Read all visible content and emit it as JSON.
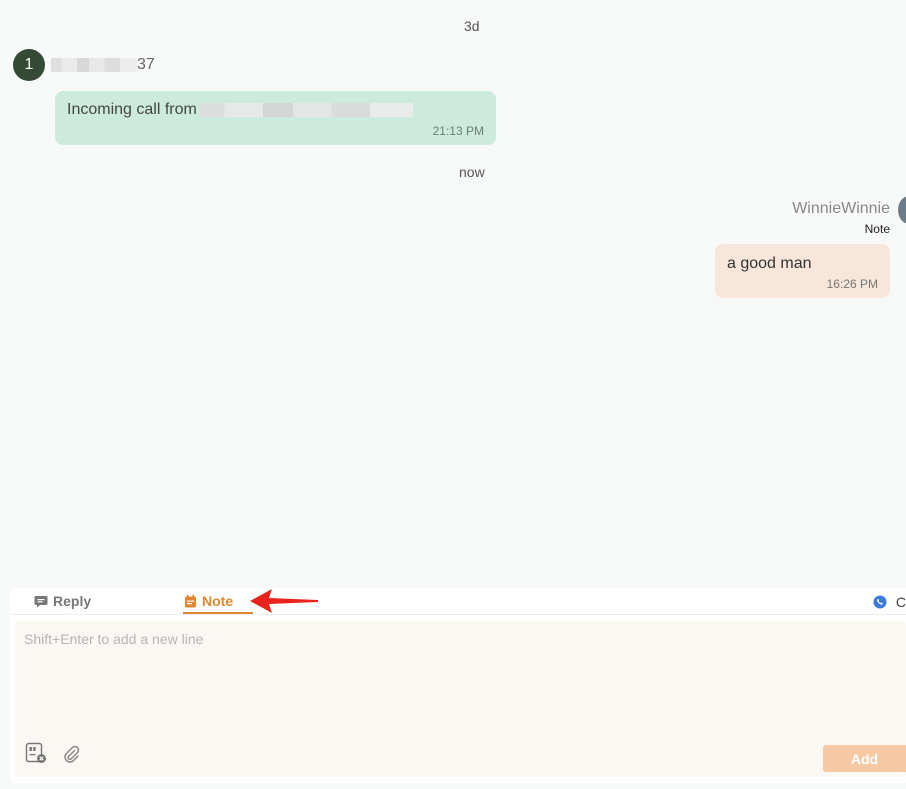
{
  "timeline": {
    "separator_1": "3d",
    "separator_2": "now"
  },
  "incoming": {
    "avatar_initial": "1",
    "sender_suffix": "37",
    "text": "Incoming call from",
    "time": "21:13 PM"
  },
  "outgoing": {
    "agent_name": "WinnieWinnie",
    "tag": "Note",
    "text": "a good man",
    "time": "16:26 PM"
  },
  "composer": {
    "tabs": [
      {
        "label": "Reply",
        "active": false
      },
      {
        "label": "Note",
        "active": true
      }
    ],
    "channel_label": "C",
    "placeholder": "Shift+Enter to add a new line",
    "add_label": "Add"
  },
  "colors": {
    "incoming_bubble": "#cdebdc",
    "note_bubble": "#f7e6d9",
    "note_accent": "#e0872f",
    "add_button": "#f6c8a4",
    "annotation_arrow": "#e8231b"
  },
  "icons": [
    "chat-icon",
    "notepad-icon",
    "whatsapp-icon",
    "template-icon",
    "paperclip-icon",
    "arrow-annotation"
  ]
}
